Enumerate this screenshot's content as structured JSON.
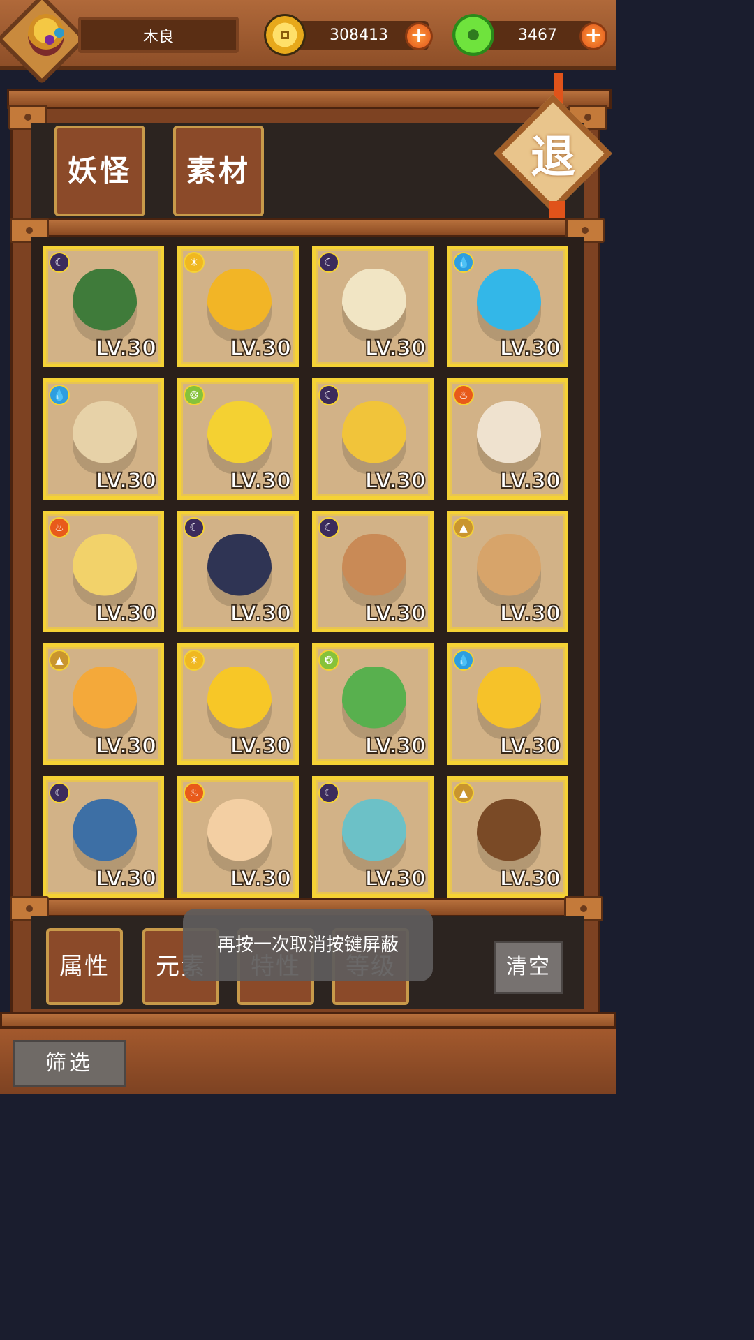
{
  "header": {
    "player_name": "木良",
    "gold_amount": "308413",
    "jade_amount": "3467"
  },
  "tabs": {
    "monsters": "妖怪",
    "materials": "素材"
  },
  "exit_label": "退",
  "cards": [
    {
      "element": "moon",
      "level": "LV.30",
      "color": "#3f7b3a"
    },
    {
      "element": "sun",
      "level": "LV.30",
      "color": "#f2b526"
    },
    {
      "element": "moon",
      "level": "LV.30",
      "color": "#f1e5c4"
    },
    {
      "element": "water",
      "level": "LV.30",
      "color": "#33b7e8"
    },
    {
      "element": "water",
      "level": "LV.30",
      "color": "#e7d2a8"
    },
    {
      "element": "wood",
      "level": "LV.30",
      "color": "#f4d132"
    },
    {
      "element": "moon",
      "level": "LV.30",
      "color": "#f1c43a"
    },
    {
      "element": "fire",
      "level": "LV.30",
      "color": "#efe2cf"
    },
    {
      "element": "fire",
      "level": "LV.30",
      "color": "#f2d26a"
    },
    {
      "element": "moon",
      "level": "LV.30",
      "color": "#2f3454"
    },
    {
      "element": "moon",
      "level": "LV.30",
      "color": "#c98a56"
    },
    {
      "element": "earth",
      "level": "LV.30",
      "color": "#d7a46a"
    },
    {
      "element": "earth",
      "level": "LV.30",
      "color": "#f4a93a"
    },
    {
      "element": "sun",
      "level": "LV.30",
      "color": "#f7c727"
    },
    {
      "element": "wood",
      "level": "LV.30",
      "color": "#58b04e"
    },
    {
      "element": "water",
      "level": "LV.30",
      "color": "#f6c229"
    },
    {
      "element": "moon",
      "level": "LV.30",
      "color": "#3d6fa5"
    },
    {
      "element": "fire",
      "level": "LV.30",
      "color": "#f3cfa3"
    },
    {
      "element": "moon",
      "level": "LV.30",
      "color": "#6cc1c7"
    },
    {
      "element": "earth",
      "level": "LV.30",
      "color": "#7a4a26"
    }
  ],
  "element_colors": {
    "moon": "#3b2b5c",
    "sun": "#f0b820",
    "water": "#2d9ee0",
    "wood": "#86c23a",
    "fire": "#e85a1a",
    "earth": "#c9952e"
  },
  "filters": {
    "attribute": "属性",
    "element": "元素",
    "trait": "特性",
    "grade": "等级",
    "clear": "清空",
    "filter": "筛选"
  },
  "toast": "再按一次取消按键屏蔽"
}
